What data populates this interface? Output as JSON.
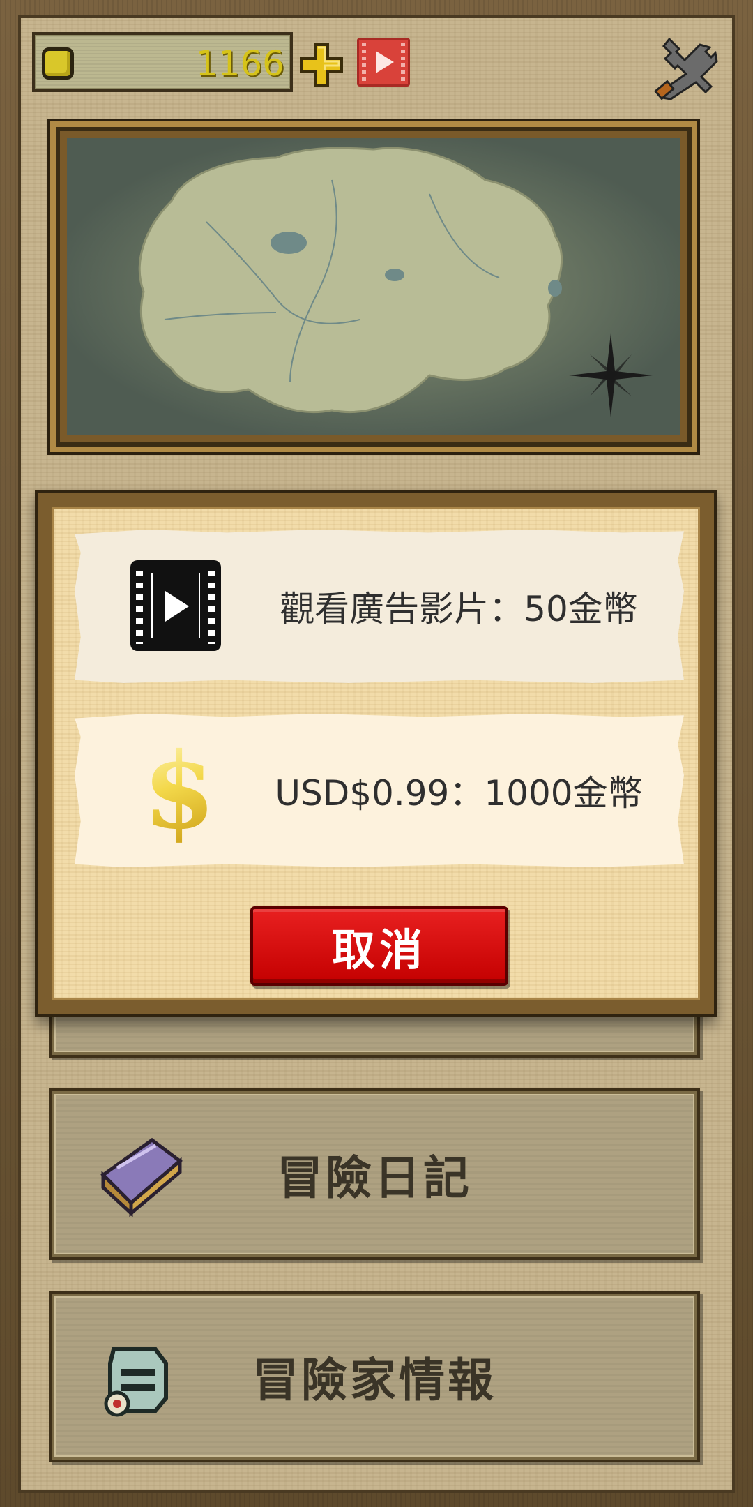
{
  "header": {
    "coin_value": "1166",
    "icons": [
      "coin-icon",
      "plus-icon",
      "video-ad-icon",
      "tools-icon"
    ]
  },
  "dialog": {
    "options": [
      {
        "icon": "film-play-icon",
        "label": "觀看廣告影片：50金幣"
      },
      {
        "icon": "dollar-icon",
        "label": "USD$0.99：1000金幣"
      }
    ],
    "cancel_label": "取消"
  },
  "menu": {
    "items": [
      {
        "icon": "journal-book-icon",
        "label": "冒險日記"
      },
      {
        "icon": "adventurer-helmet-icon",
        "label": "冒險家情報"
      }
    ]
  },
  "colors": {
    "coin_text": "#d6c31a",
    "cancel_button": "#d40a0a",
    "menu_card": "#aea181",
    "dialog_paper": "#f2dcaa"
  }
}
